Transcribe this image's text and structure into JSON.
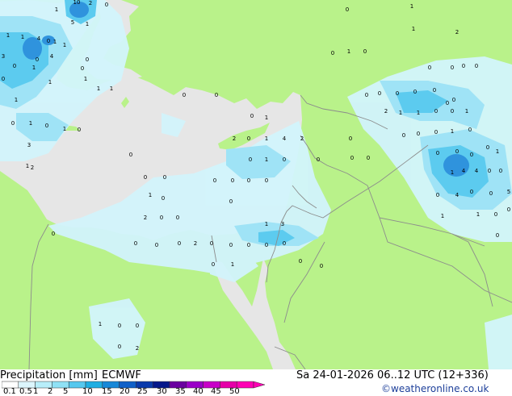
{
  "map": {
    "colors": {
      "land": "#b9f28a",
      "sea": "#e6e6e6",
      "border": "#8c8c8c",
      "precip_light": "#d2f4fc",
      "precip_mid": "#9fe3f6",
      "precip_high": "#5ccbef",
      "precip_strong": "#2f93dd"
    },
    "value_labels": [
      "10",
      "2",
      "0",
      "1",
      "5",
      "1",
      "1",
      "1",
      "4",
      "0",
      "1",
      "1",
      "3",
      "4",
      "0",
      "0",
      "0",
      "1",
      "0",
      "1",
      "1",
      "1",
      "1",
      "1",
      "0",
      "0",
      "1",
      "0",
      "1",
      "0",
      "3",
      "1",
      "2",
      "0",
      "1",
      "1",
      "2",
      "0",
      "1",
      "0",
      "0",
      "0",
      "0",
      "0",
      "0",
      "0",
      "0",
      "0",
      "0",
      "0",
      "0",
      "0",
      "0",
      "0",
      "1",
      "2",
      "0",
      "1",
      "4",
      "2",
      "0",
      "0",
      "0",
      "0",
      "2",
      "1",
      "1",
      "0",
      "0",
      "1",
      "0",
      "0",
      "0",
      "1",
      "0",
      "0",
      "1",
      "0",
      "0",
      "0",
      "0",
      "0",
      "1",
      "4",
      "4",
      "0",
      "4",
      "0",
      "0",
      "5",
      "1",
      "1",
      "0",
      "0",
      "0",
      "0",
      "0",
      "0",
      "1",
      "0",
      "0",
      "0",
      "0",
      "0",
      "0",
      "1",
      "0",
      "0",
      "2",
      "0",
      "0",
      "0",
      "0",
      "0",
      "0",
      "2",
      "0",
      "0",
      "0",
      "0",
      "0",
      "1",
      "3",
      "0",
      "0",
      "0",
      "1",
      "1",
      "0",
      "0",
      "0",
      "2"
    ]
  },
  "legend": {
    "title": "Precipitation [mm]",
    "model": "ECMWF",
    "ticks": [
      "0.1",
      "0.5",
      "1",
      "2",
      "5",
      "10",
      "15",
      "20",
      "25",
      "30",
      "35",
      "40",
      "45",
      "50"
    ],
    "colors": [
      "#ffffff",
      "#dcf6fd",
      "#b8eefa",
      "#8fe1f5",
      "#55c8ee",
      "#1eaee2",
      "#1888d8",
      "#1060c8",
      "#0a3aab",
      "#05188a",
      "#6a00a0",
      "#9a00c8",
      "#c800c8",
      "#e600a8",
      "#ff00b4"
    ]
  },
  "valid_time": "Sa 24-01-2026 06..12 UTC (12+336)",
  "credit": "©weatheronline.co.uk"
}
